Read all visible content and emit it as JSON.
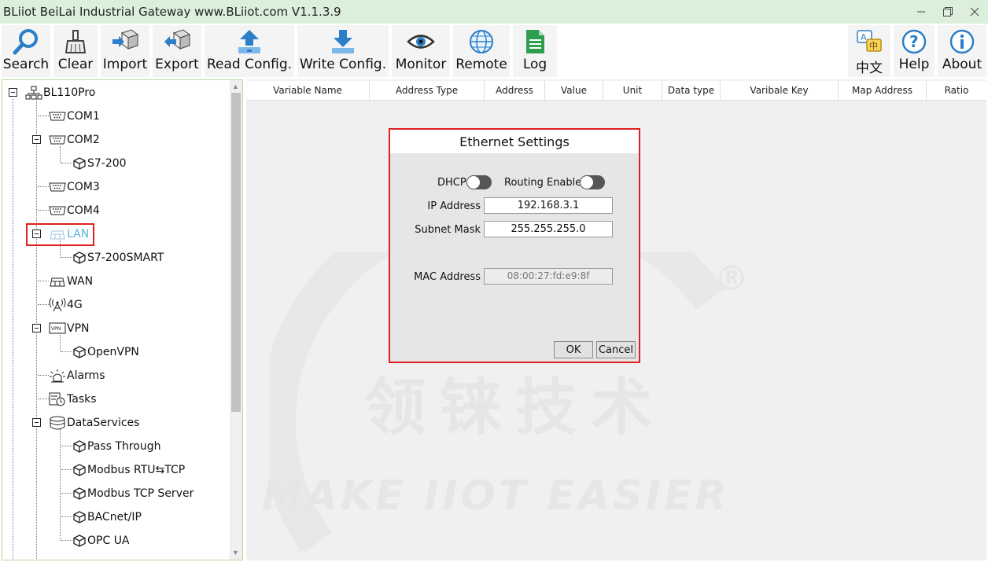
{
  "window": {
    "title": "BLiiot BeiLai Industrial Gateway www.BLiiot.com V1.1.3.9",
    "title_color": "#dcefdc"
  },
  "toolbar": {
    "buttons": [
      {
        "label": "Search",
        "icon": "search-icon"
      },
      {
        "label": "Clear",
        "icon": "broom-icon"
      },
      {
        "label": "Import",
        "icon": "import-icon"
      },
      {
        "label": "Export",
        "icon": "export-icon"
      },
      {
        "label": "Read Config.",
        "icon": "upload-icon"
      },
      {
        "label": "Write Config.",
        "icon": "download-icon"
      },
      {
        "label": "Monitor",
        "icon": "eye-icon"
      },
      {
        "label": "Remote",
        "icon": "globe-icon"
      },
      {
        "label": "Log",
        "icon": "log-icon"
      },
      {
        "label": "中文",
        "icon": "language-icon"
      },
      {
        "label": "Help",
        "icon": "help-icon"
      },
      {
        "label": "About",
        "icon": "info-icon"
      }
    ]
  },
  "tree": {
    "items": [
      {
        "label": "BL110Pro",
        "icon": "network-icon"
      },
      {
        "label": "COM1",
        "icon": "serial-port-icon"
      },
      {
        "label": "COM2",
        "icon": "serial-port-icon"
      },
      {
        "label": "S7-200",
        "icon": "cube-icon"
      },
      {
        "label": "COM3",
        "icon": "serial-port-icon"
      },
      {
        "label": "COM4",
        "icon": "serial-port-icon"
      },
      {
        "label": "LAN",
        "icon": "lan-icon"
      },
      {
        "label": "S7-200SMART",
        "icon": "cube-icon"
      },
      {
        "label": "WAN",
        "icon": "wan-icon"
      },
      {
        "label": "4G",
        "icon": "antenna-icon"
      },
      {
        "label": "VPN",
        "icon": "vpn-icon"
      },
      {
        "label": "OpenVPN",
        "icon": "cube-icon"
      },
      {
        "label": "Alarms",
        "icon": "alarm-icon"
      },
      {
        "label": "Tasks",
        "icon": "tasks-icon"
      },
      {
        "label": "DataServices",
        "icon": "database-icon"
      },
      {
        "label": "Pass Through",
        "icon": "cube-icon"
      },
      {
        "label": "Modbus RTU⇆TCP",
        "icon": "cube-icon"
      },
      {
        "label": "Modbus TCP Server",
        "icon": "cube-icon"
      },
      {
        "label": "BACnet/IP",
        "icon": "cube-icon"
      },
      {
        "label": "OPC UA",
        "icon": "cube-icon"
      }
    ]
  },
  "table": {
    "columns": [
      "Variable Name",
      "Address Type",
      "Address",
      "Value",
      "Unit",
      "Data type",
      "Varibale Key",
      "Map Address",
      "Ratio"
    ]
  },
  "dialog": {
    "title": "Ethernet Settings",
    "dhcp_label": "DHCP",
    "routing_label": "Routing Enabled",
    "dhcp_enabled": false,
    "routing_enabled": false,
    "ip_label": "IP Address",
    "ip_value": "192.168.3.1",
    "mask_label": "Subnet Mask",
    "mask_value": "255.255.255.0",
    "mac_label": "MAC Address",
    "mac_value": "08:00:27:fd:e9:8f",
    "ok_label": "OK",
    "cancel_label": "Cancel",
    "border_color": "#e02020"
  },
  "watermark": {
    "text": "MAKE IIOT EASIER",
    "cn_text": "领铼技术",
    "mark": "®"
  }
}
